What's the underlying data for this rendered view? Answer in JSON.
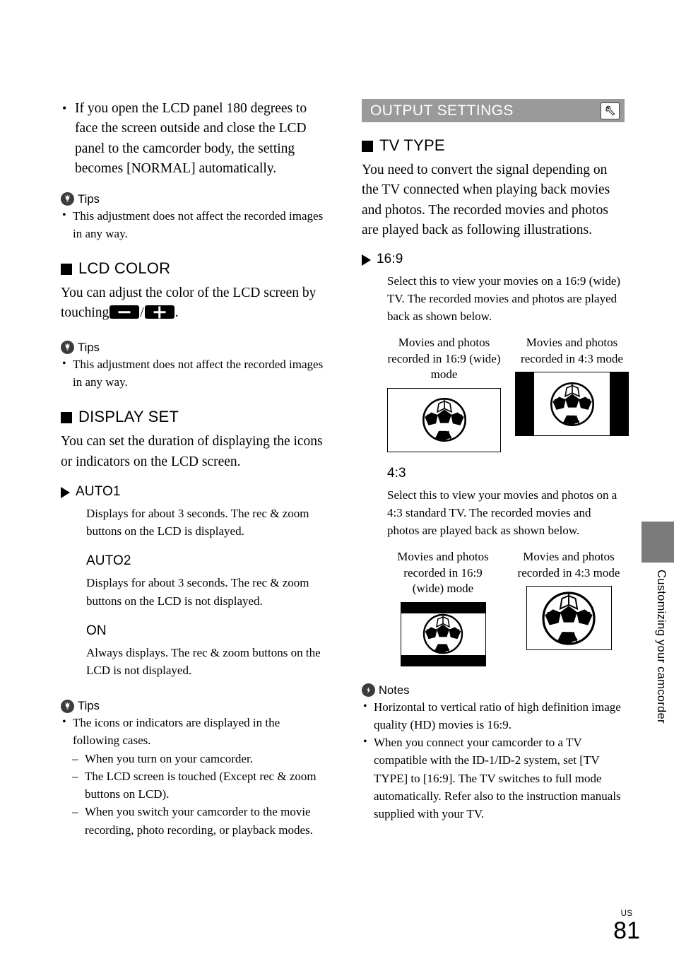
{
  "page": {
    "number": "81",
    "region_code": "US",
    "side_tab": "Customizing your camcorder"
  },
  "left_column": {
    "intro_bullet": "If you open the LCD panel 180 degrees to face the screen outside and close the LCD panel to the camcorder body, the setting becomes [NORMAL] automatically.",
    "tips_1": {
      "icon": "lightbulb-icon",
      "label": "Tips",
      "items": [
        "This adjustment does not affect the recorded images in any way."
      ]
    },
    "lcd_color": {
      "heading": "LCD COLOR",
      "text_before": "You can adjust the color of the LCD screen by touching",
      "key_minus": "minus-key-icon",
      "key_separator": "/",
      "key_plus": "plus-key-icon",
      "text_after": "."
    },
    "tips_2": {
      "icon": "lightbulb-icon",
      "label": "Tips",
      "items": [
        "This adjustment does not affect the recorded images in any way."
      ]
    },
    "display_set": {
      "heading": "DISPLAY SET",
      "description": "You can set the duration of displaying the icons or indicators on the LCD screen.",
      "options": [
        {
          "name": "AUTO1",
          "default": true,
          "description": "Displays for about 3 seconds. The rec & zoom buttons on the LCD is displayed."
        },
        {
          "name": "AUTO2",
          "default": false,
          "description": "Displays for about 3 seconds. The rec & zoom buttons on the LCD is not displayed."
        },
        {
          "name": "ON",
          "default": false,
          "description": "Always displays. The rec & zoom buttons on the LCD is not displayed."
        }
      ]
    },
    "tips_3": {
      "icon": "lightbulb-icon",
      "label": "Tips",
      "lead": "The icons or indicators are displayed in the following cases.",
      "sub_items": [
        "When you turn on your camcorder.",
        "The LCD screen is touched (Except rec & zoom buttons on LCD).",
        "When you switch your camcorder to the movie recording, photo recording, or playback modes."
      ]
    }
  },
  "right_column": {
    "section_bar": {
      "title": "OUTPUT SETTINGS",
      "icon": "wrench-icon"
    },
    "tv_type": {
      "heading": "TV TYPE",
      "description": "You need to convert the signal depending on the TV connected when playing back movies and photos. The recorded movies and photos are played back as following illustrations.",
      "options": [
        {
          "name": "16:9",
          "default": true,
          "description": "Select this to view your movies on a 16:9 (wide) TV. The recorded movies and photos are played back as shown below.",
          "figures": [
            {
              "caption": "Movies and photos recorded in 16:9 (wide) mode",
              "frame": "16:9",
              "bars": "none"
            },
            {
              "caption": "Movies and photos recorded in 4:3 mode",
              "frame": "16:9",
              "bars": "pillarbox"
            }
          ]
        },
        {
          "name": "4:3",
          "default": false,
          "description": "Select this to view your movies and photos on a 4:3 standard TV. The recorded movies and photos are played back as shown below.",
          "figures": [
            {
              "caption": "Movies and photos recorded in 16:9 (wide) mode",
              "frame": "4:3",
              "bars": "letterbox"
            },
            {
              "caption": "Movies and photos recorded in 4:3 mode",
              "frame": "4:3",
              "bars": "none"
            }
          ]
        }
      ]
    },
    "notes": {
      "icon": "lightning-bolt-icon",
      "label": "Notes",
      "items": [
        "Horizontal to vertical ratio of high definition image quality (HD) movies is 16:9.",
        "When you connect your camcorder to a TV compatible with the ID-1/ID-2 system, set [TV TYPE] to [16:9]. The TV switches to full mode automatically. Refer also to the instruction manuals supplied with your TV."
      ]
    }
  },
  "colors": {
    "section_bar_bg": "#9a9a9a",
    "section_bar_text": "#ffffff",
    "thumb_tab": "#7b7b7b",
    "icon_circle": "#3c3c3c",
    "ink": "#000000",
    "paper": "#ffffff"
  }
}
